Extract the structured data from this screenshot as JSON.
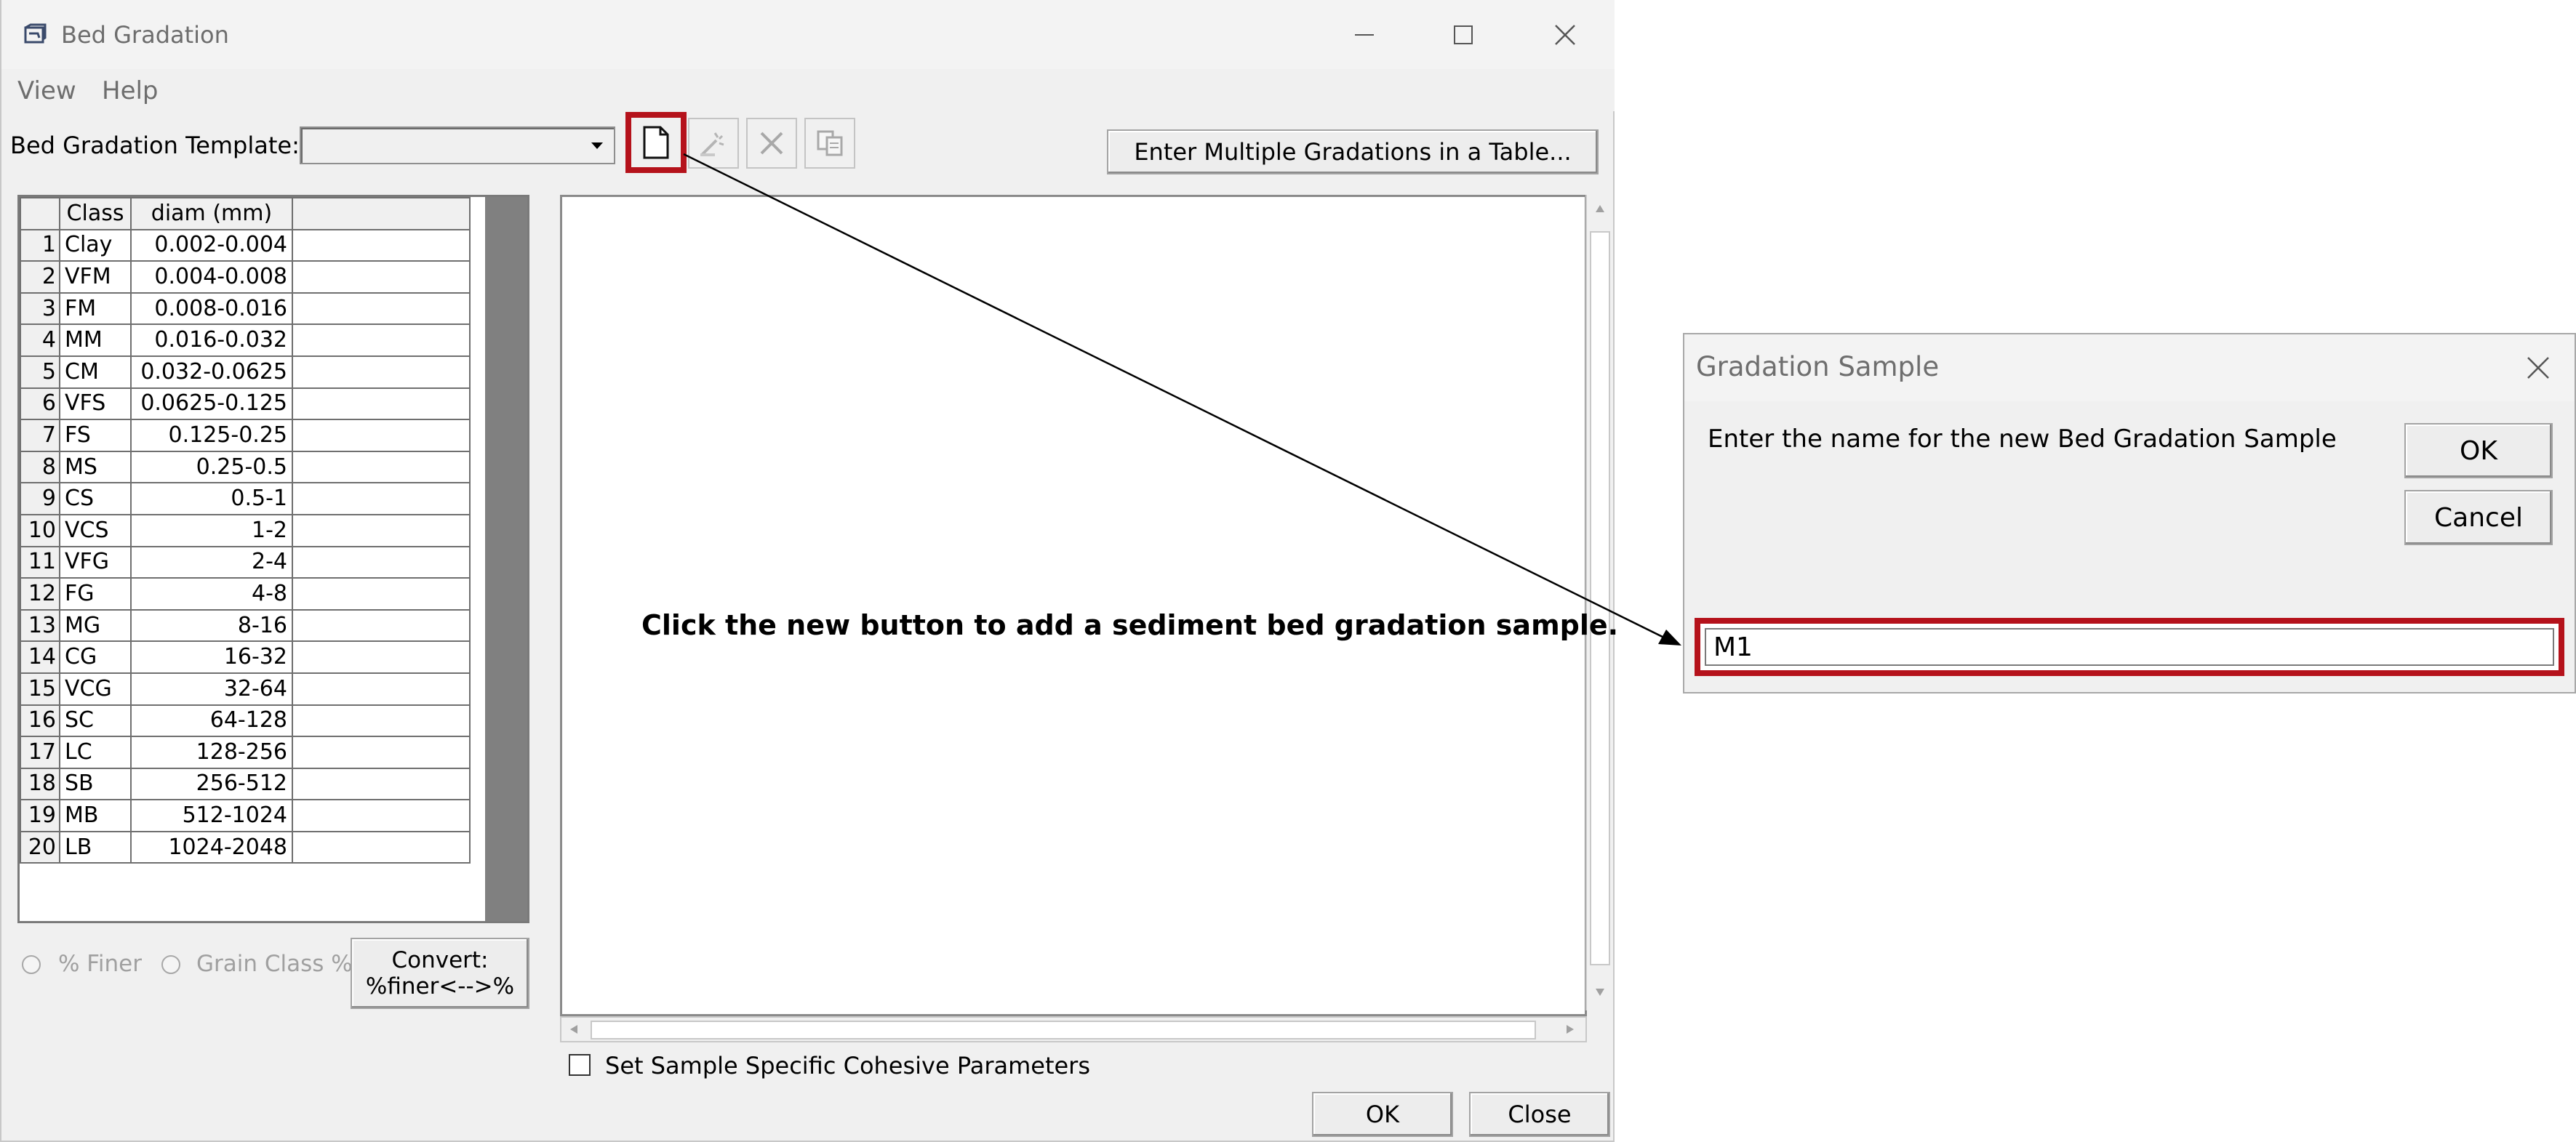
{
  "window": {
    "title": "Bed Gradation",
    "menu": [
      "View",
      "Help"
    ]
  },
  "toolbar": {
    "template_label": "Bed Gradation Template:",
    "template_value": "",
    "multi_button": "Enter Multiple Gradations in a Table..."
  },
  "grid": {
    "headers": [
      "",
      "Class",
      "diam (mm)",
      ""
    ],
    "rows": [
      {
        "n": "1",
        "cls": "Clay",
        "diam": "0.002-0.004"
      },
      {
        "n": "2",
        "cls": "VFM",
        "diam": "0.004-0.008"
      },
      {
        "n": "3",
        "cls": "FM",
        "diam": "0.008-0.016"
      },
      {
        "n": "4",
        "cls": "MM",
        "diam": "0.016-0.032"
      },
      {
        "n": "5",
        "cls": "CM",
        "diam": "0.032-0.0625"
      },
      {
        "n": "6",
        "cls": "VFS",
        "diam": "0.0625-0.125"
      },
      {
        "n": "7",
        "cls": "FS",
        "diam": "0.125-0.25"
      },
      {
        "n": "8",
        "cls": "MS",
        "diam": "0.25-0.5"
      },
      {
        "n": "9",
        "cls": "CS",
        "diam": "0.5-1"
      },
      {
        "n": "10",
        "cls": "VCS",
        "diam": "1-2"
      },
      {
        "n": "11",
        "cls": "VFG",
        "diam": "2-4"
      },
      {
        "n": "12",
        "cls": "FG",
        "diam": "4-8"
      },
      {
        "n": "13",
        "cls": "MG",
        "diam": "8-16"
      },
      {
        "n": "14",
        "cls": "CG",
        "diam": "16-32"
      },
      {
        "n": "15",
        "cls": "VCG",
        "diam": "32-64"
      },
      {
        "n": "16",
        "cls": "SC",
        "diam": "64-128"
      },
      {
        "n": "17",
        "cls": "LC",
        "diam": "128-256"
      },
      {
        "n": "18",
        "cls": "SB",
        "diam": "256-512"
      },
      {
        "n": "19",
        "cls": "MB",
        "diam": "512-1024"
      },
      {
        "n": "20",
        "cls": "LB",
        "diam": "1024-2048"
      }
    ]
  },
  "options": {
    "finer_label": "% Finer",
    "grain_label": "Grain Class %",
    "convert_line1": "Convert:",
    "convert_line2": "%finer<-->%"
  },
  "panel": {
    "message": "Click the new button to add a sediment bed gradation sample."
  },
  "footer": {
    "cohesive_label": "Set Sample Specific Cohesive Parameters",
    "ok": "OK",
    "close": "Close"
  },
  "dialog": {
    "title": "Gradation Sample",
    "prompt": "Enter the name for the new Bed Gradation Sample",
    "ok": "OK",
    "cancel": "Cancel",
    "input_value": "M1"
  },
  "colors": {
    "highlight": "#b5121b"
  }
}
